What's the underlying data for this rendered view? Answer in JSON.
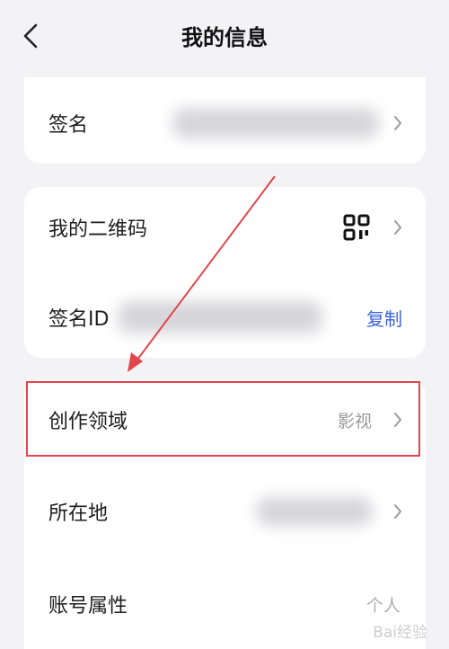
{
  "header": {
    "title": "我的信息"
  },
  "card1": {
    "signature_label": "签名"
  },
  "card2": {
    "qrcode_label": "我的二维码",
    "sign_id_label": "签名ID",
    "copy_label": "复制"
  },
  "card3": {
    "field_label": "创作领域",
    "field_value": "影视",
    "location_label": "所在地",
    "account_label": "账号属性",
    "account_value": "个人"
  },
  "watermark": {
    "logo_text": "Bai经验"
  },
  "colors": {
    "background": "#f3f3f5",
    "card": "#ffffff",
    "accent_link": "#3b63d8",
    "annotation_red": "#e2454b"
  }
}
